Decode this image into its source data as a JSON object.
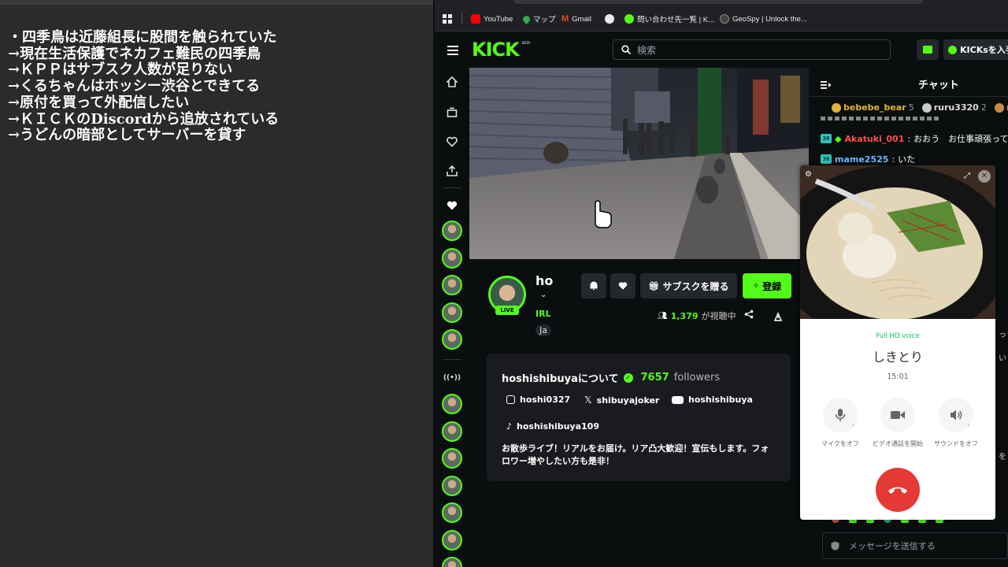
{
  "notes": [
    "・四季鳥は近藤組長に股間を触られていた",
    "→現在生活保護でネカフェ難民の四季鳥",
    "→ＫＰＰはサブスク人数が足りない",
    "→くるちゃんはホッシー渋谷とできてる",
    "→原付を買って外配信したい",
    "→ＫＩＣＫのDiscordから追放されている",
    "→うどんの暗部としてサーバーを貸す"
  ],
  "bookmarks": [
    {
      "label": "YouTube",
      "icon": "youtube-icon",
      "color": "#ff0000"
    },
    {
      "label": "マップ",
      "icon": "maps-icon",
      "color": "#34a853"
    },
    {
      "label": "Gmail",
      "icon": "gmail-icon",
      "color": "#ea4335"
    },
    {
      "label": "",
      "icon": "globe-icon",
      "color": "#e8eaed"
    },
    {
      "label": "問い合わせ先一覧 | K...",
      "icon": "kick-favicon-icon",
      "color": "#53fc18"
    },
    {
      "label": "GeoSpy | Unlock the...",
      "icon": "geospy-icon",
      "color": "#444444"
    }
  ],
  "header": {
    "logo": "KICK",
    "logo_beta": "BETA",
    "search_placeholder": "検索",
    "kicks_button": "KICKsを入手"
  },
  "channel": {
    "name": "ho",
    "category": "IRL",
    "language_tag": "Ja",
    "live_badge": "LIVE",
    "subscribe_gift": "サブスクを贈る",
    "follow": "登録",
    "viewers": "1,379",
    "viewers_suffix": "が視聴中"
  },
  "about": {
    "title": "hoshishibuyaについて",
    "followers_count": "7657",
    "followers_label": "followers",
    "links": [
      {
        "icon": "instagram-icon",
        "label": "hoshi0327"
      },
      {
        "icon": "x-icon",
        "label": "shibuyajoker"
      },
      {
        "icon": "youtube-icon",
        "label": "hoshishibuya"
      },
      {
        "icon": "tiktok-icon",
        "label": "hoshishibuya109"
      }
    ],
    "description": "お散歩ライブ！リアルをお届け。リア凸大歓迎！宣伝もします。フォロワー増やしたい方も是非！"
  },
  "chat": {
    "title": "チャット",
    "gifters": [
      {
        "name": "bebebe_bear",
        "count": "5",
        "color": "#e2b23c"
      },
      {
        "name": "ruru3320",
        "count": "2",
        "color": "#c9c9c9"
      },
      {
        "name": "r",
        "count": "",
        "color": "#c98a4b"
      }
    ],
    "messages": [
      {
        "user": "Akatuki_001",
        "text": "おおう　お仕事頑張って",
        "user_color": "#ff4d4d"
      },
      {
        "user": "mame2525",
        "text": "いた",
        "user_color": "#6fb7ff"
      }
    ],
    "input_placeholder": "メッセージを送信する"
  },
  "call": {
    "quality": "Full HD voice",
    "caller": "しきとり",
    "timer": "15:01",
    "mic_label": "マイクをオフ",
    "video_label": "ビデオ通話を開始",
    "sound_label": "サウンドをオフ"
  },
  "colors": {
    "kick_green": "#53fc18",
    "call_red": "#e53935"
  }
}
